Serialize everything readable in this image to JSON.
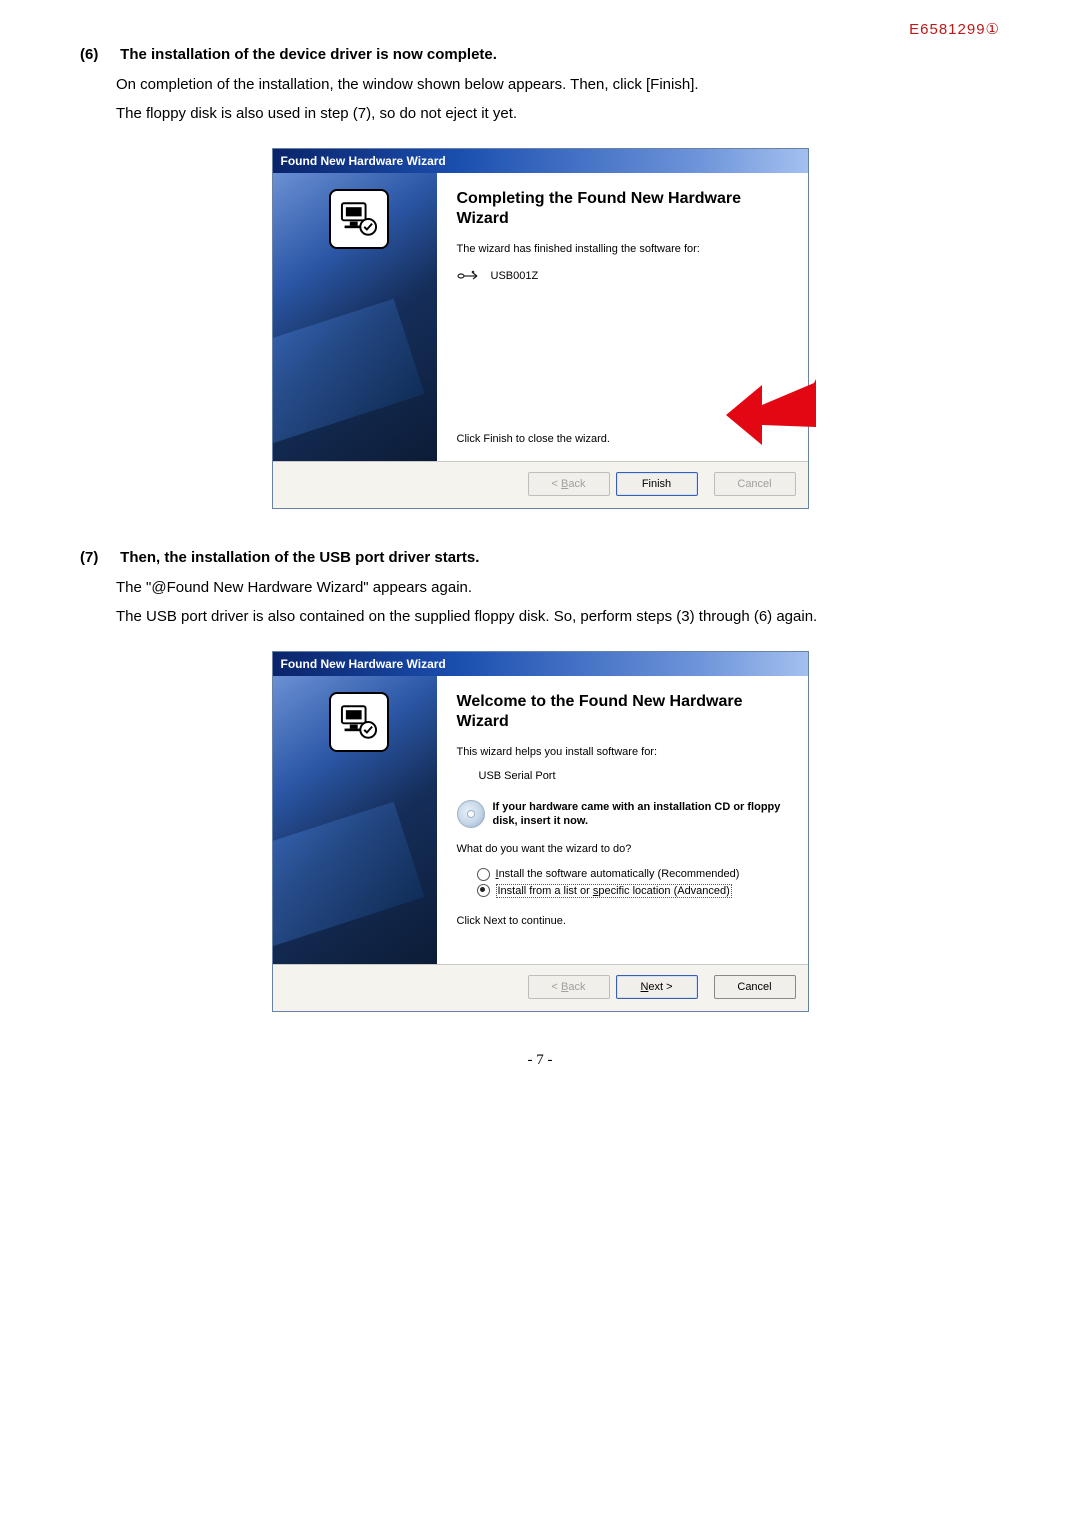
{
  "doc_id": "E6581299①",
  "section6": {
    "num": "(6)",
    "title": "The installation of the device driver is now complete.",
    "body_line1": "On completion of the installation, the window shown below appears. Then, click [Finish].",
    "body_line2": "The floppy disk is also used in step (7), so do not eject it yet."
  },
  "wizard1": {
    "title": "Found New Hardware Wizard",
    "heading": "Completing the Found New Hardware Wizard",
    "line_finished": "The wizard has finished installing the software for:",
    "device": "USB001Z",
    "close_hint": "Click Finish to close the wizard.",
    "back_label": "< Back",
    "finish_label": "Finish",
    "cancel_label": "Cancel"
  },
  "section7": {
    "num": "(7)",
    "title": "Then, the installation of the USB port driver starts.",
    "body_line1": "The \"@Found New Hardware Wizard\" appears again.",
    "body_line2": "The USB port driver is also contained on the supplied floppy disk. So, perform steps (3) through (6) again."
  },
  "wizard2": {
    "title": "Found New Hardware Wizard",
    "heading": "Welcome to the Found New Hardware Wizard",
    "line_helps": "This wizard helps you install software for:",
    "device": "USB Serial Port",
    "info_text": "If your hardware came with an installation CD or floppy disk, insert it now.",
    "question": "What do you want the wizard to do?",
    "radio1_pre": "I",
    "radio1_rest": "nstall the software automatically (Recommended)",
    "radio2_pre": "Install from a list or ",
    "radio2_under": "s",
    "radio2_post": "pecific location (Advanced)",
    "click_next": "Click Next to continue.",
    "back_label": "< Back",
    "next_label_pre": "N",
    "next_label_post": "ext >",
    "cancel_label": "Cancel"
  },
  "page_number": "- 7 -"
}
